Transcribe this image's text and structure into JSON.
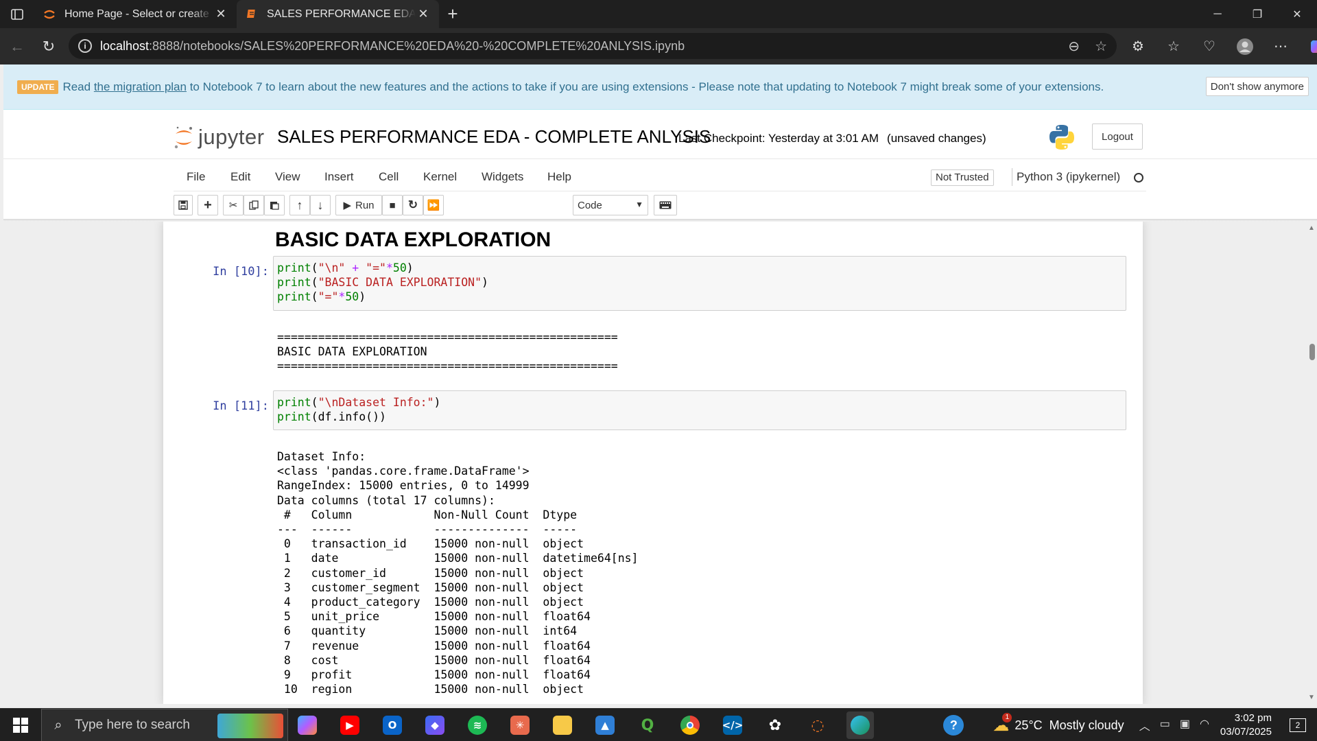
{
  "browser": {
    "tabs": [
      {
        "title": "Home Page - Select or create a notebook",
        "active": false
      },
      {
        "title": "SALES PERFORMANCE EDA - COMPLETE ANLYSIS",
        "active": true
      }
    ],
    "url_host": "localhost",
    "url_path": ":8888/notebooks/SALES%20PERFORMANCE%20EDA%20-%20COMPLETE%20ANLYSIS.ipynb"
  },
  "banner": {
    "badge": "UPDATE",
    "text_before": "Read",
    "link": "the migration plan",
    "text_after": "to Notebook 7 to learn about the new features and the actions to take if you are using extensions - Please note that updating to Notebook 7 might break some of your extensions.",
    "dismiss": "Don't show anymore"
  },
  "header": {
    "logo_text": "jupyter",
    "notebook_title": "SALES PERFORMANCE EDA - COMPLETE ANLYSIS",
    "checkpoint": "Last Checkpoint: Yesterday at 3:01 AM",
    "unsaved": "(unsaved changes)",
    "logout": "Logout"
  },
  "menu": {
    "items": [
      "File",
      "Edit",
      "View",
      "Insert",
      "Cell",
      "Kernel",
      "Widgets",
      "Help"
    ],
    "trusted": "Not Trusted",
    "kernel": "Python 3 (ipykernel)"
  },
  "toolbar": {
    "run_label": "Run",
    "cell_type": "Code"
  },
  "notebook": {
    "heading": "BASIC DATA EXPLORATION",
    "cell1": {
      "prompt": "In [10]:",
      "output": "==================================================\nBASIC DATA EXPLORATION\n=================================================="
    },
    "cell2": {
      "prompt": "In [11]:",
      "output": "Dataset Info:\n<class 'pandas.core.frame.DataFrame'>\nRangeIndex: 15000 entries, 0 to 14999\nData columns (total 17 columns):\n #   Column            Non-Null Count  Dtype\n---  ------            --------------  -----\n 0   transaction_id    15000 non-null  object\n 1   date              15000 non-null  datetime64[ns]\n 2   customer_id       15000 non-null  object\n 3   customer_segment  15000 non-null  object\n 4   product_category  15000 non-null  object\n 5   unit_price        15000 non-null  float64\n 6   quantity          15000 non-null  int64\n 7   revenue           15000 non-null  float64\n 8   cost              15000 non-null  float64\n 9   profit            15000 non-null  float64\n 10  region            15000 non-null  object"
    }
  },
  "taskbar": {
    "search_placeholder": "Type here to search",
    "weather": "25°C  Mostly cloudy",
    "weather_badge": "1",
    "time": "3:02 pm",
    "date": "03/07/2025",
    "notifications": "2"
  }
}
